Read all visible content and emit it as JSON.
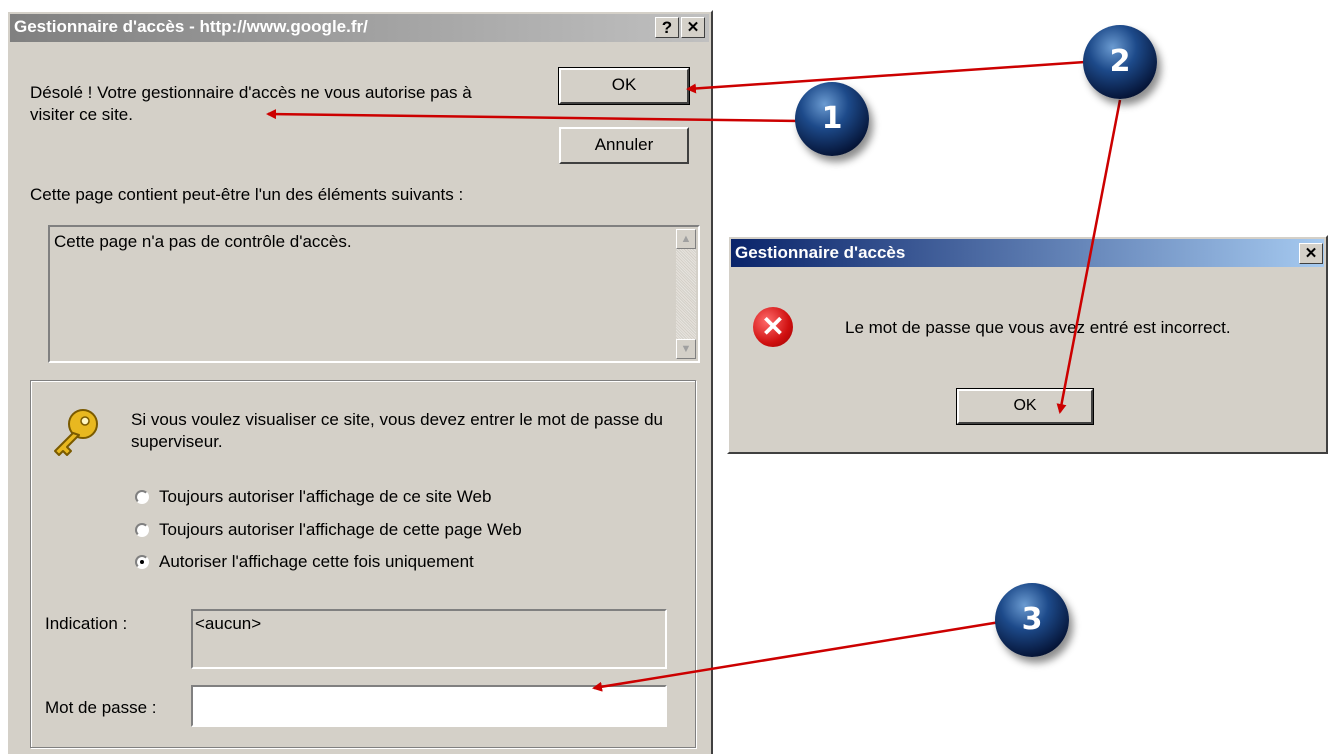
{
  "main_dialog": {
    "title": "Gestionnaire d'accès - http://www.google.fr/",
    "help_button": "?",
    "close_button": "✕",
    "message": "Désolé ! Votre gestionnaire d'accès ne vous autorise pas à visiter ce site.",
    "ok_label": "OK",
    "cancel_label": "Annuler",
    "contents_intro": "Cette page contient peut-être l'un des éléments suivants :",
    "contents_list_text": "Cette page n'a pas de contrôle d'accès.",
    "supervisor_text": "Si vous voulez visualiser ce site, vous devez entrer le mot de passe du superviseur.",
    "options": [
      {
        "label": "Toujours autoriser l'affichage de ce site Web",
        "checked": false
      },
      {
        "label": "Toujours autoriser l'affichage de cette page Web",
        "checked": false
      },
      {
        "label": "Autoriser l'affichage cette fois uniquement",
        "checked": true
      }
    ],
    "hint_label": "Indication :",
    "hint_value": "<aucun>",
    "password_label": "Mot de passe :",
    "password_value": ""
  },
  "error_dialog": {
    "title": "Gestionnaire d'accès",
    "close_button": "✕",
    "message": "Le mot de passe que vous avez entré est incorrect.",
    "ok_label": "OK",
    "icon": "error-x-icon"
  },
  "callouts": [
    "1",
    "2",
    "3"
  ],
  "colors": {
    "dialog_bg": "#d4d0c8",
    "active_title": "#0a246a",
    "inactive_title": "#808080",
    "arrow": "#cc0000"
  }
}
